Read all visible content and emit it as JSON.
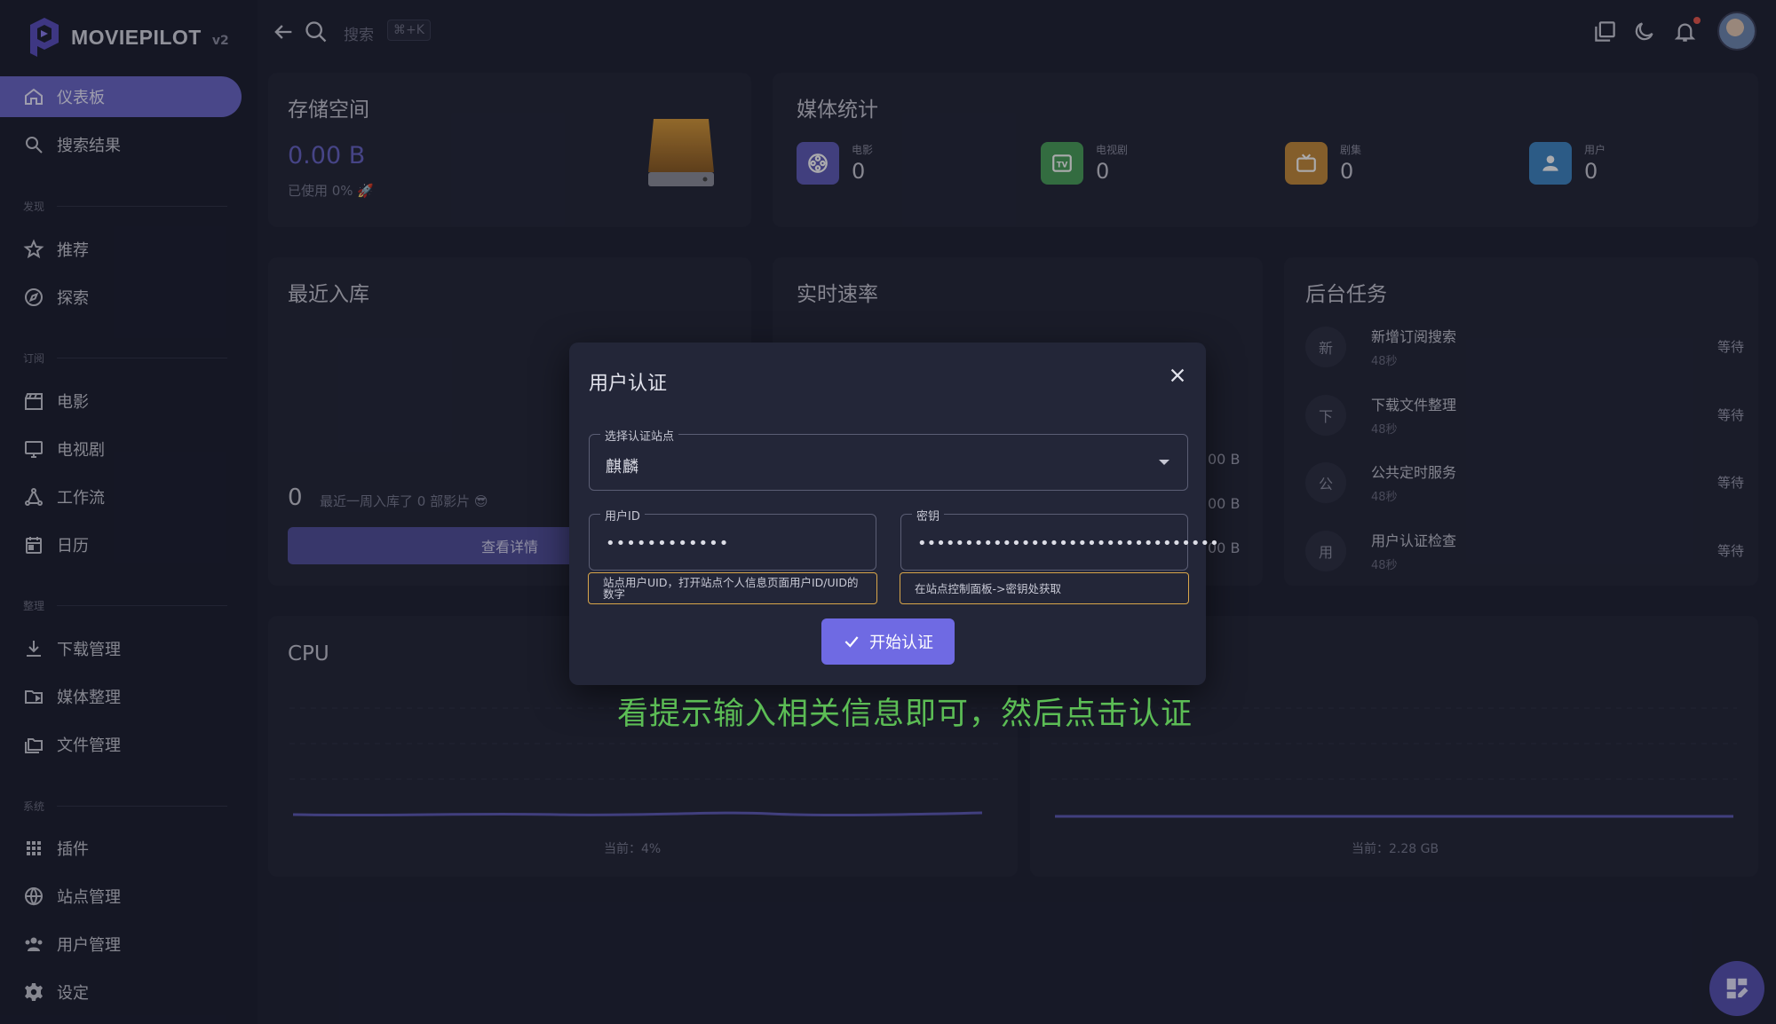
{
  "app": {
    "name": "MOVIEPILOT",
    "version": "v2"
  },
  "topbar": {
    "search_placeholder": "搜索",
    "shortcut": "⌘+K"
  },
  "sidebar": {
    "items": [
      {
        "label": "仪表板",
        "icon": "home-icon",
        "active": true
      },
      {
        "label": "搜索结果",
        "icon": "search-icon"
      },
      {
        "label": "推荐",
        "icon": "star-icon"
      },
      {
        "label": "探索",
        "icon": "compass-icon"
      },
      {
        "label": "电影",
        "icon": "clapperboard-icon"
      },
      {
        "label": "电视剧",
        "icon": "monitor-icon"
      },
      {
        "label": "工作流",
        "icon": "workflow-icon"
      },
      {
        "label": "日历",
        "icon": "calendar-icon"
      },
      {
        "label": "下载管理",
        "icon": "download-icon"
      },
      {
        "label": "媒体整理",
        "icon": "folder-media-icon"
      },
      {
        "label": "文件管理",
        "icon": "folders-icon"
      },
      {
        "label": "插件",
        "icon": "grid-icon"
      },
      {
        "label": "站点管理",
        "icon": "globe-icon"
      },
      {
        "label": "用户管理",
        "icon": "users-icon"
      },
      {
        "label": "设定",
        "icon": "gear-icon"
      }
    ],
    "sections": [
      "发现",
      "订阅",
      "整理",
      "系统"
    ]
  },
  "storage": {
    "title": "存储空间",
    "value": "0.00 B",
    "used": "已使用 0% 🚀"
  },
  "media_stats": {
    "title": "媒体统计",
    "items": [
      {
        "label": "电影",
        "value": "0",
        "color": "#5e5bb8"
      },
      {
        "label": "电视剧",
        "value": "0",
        "color": "#4aa05a"
      },
      {
        "label": "剧集",
        "value": "0",
        "color": "#c48b3a"
      },
      {
        "label": "用户",
        "value": "0",
        "color": "#3f86c4"
      }
    ]
  },
  "recent": {
    "title": "最近入库",
    "count": "0",
    "desc": "最近一周入库了 0 部影片 😎",
    "button": "查看详情"
  },
  "speed": {
    "title": "实时速率",
    "values": [
      "00 B",
      "00 B",
      "00 B"
    ]
  },
  "tasks": {
    "title": "后台任务",
    "items": [
      {
        "avatar": "新",
        "name": "新增订阅搜索",
        "time": "48秒",
        "status": "等待"
      },
      {
        "avatar": "下",
        "name": "下载文件整理",
        "time": "48秒",
        "status": "等待"
      },
      {
        "avatar": "公",
        "name": "公共定时服务",
        "time": "48秒",
        "status": "等待"
      },
      {
        "avatar": "用",
        "name": "用户认证检查",
        "time": "48秒",
        "status": "等待"
      }
    ]
  },
  "cpu": {
    "title": "CPU",
    "current": "当前：4%"
  },
  "memory": {
    "current": "当前：2.28 GB"
  },
  "dialog": {
    "title": "用户认证",
    "site_label": "选择认证站点",
    "site_value": "麒麟",
    "uid_label": "用户ID",
    "uid_value": "••••••••••••",
    "uid_hint": "站点用户UID，打开站点个人信息页面用户ID/UID的数字",
    "key_label": "密钥",
    "key_value": "••••••••••••••••••••••••••••••••",
    "key_hint": "在站点控制面板->密钥处获取",
    "submit": "开始认证"
  },
  "annotation": "看提示输入相关信息即可，然后点击认证"
}
